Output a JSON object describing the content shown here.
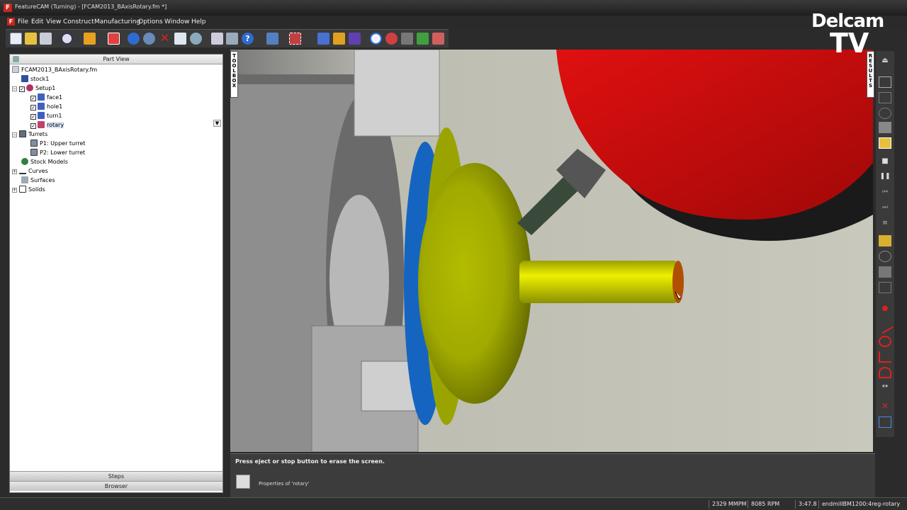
{
  "window": {
    "title": "FeatureCAM (Turning) - [FCAM2013_BAxisRotary.fm *]"
  },
  "menu": {
    "items": [
      "File",
      "Edit",
      "View",
      "Construct",
      "Manufacturing",
      "Options",
      "Window",
      "Help"
    ]
  },
  "logo": {
    "line1": "Delcam",
    "line2": "TV"
  },
  "panel": {
    "title": "Part View",
    "tree": [
      {
        "label": "FCAM2013_BAxisRotary.fm",
        "icon": "document-icon"
      },
      {
        "label": "stock1",
        "icon": "stock-icon"
      },
      {
        "label": "Setup1",
        "icon": "setup-icon"
      },
      {
        "label": "face1",
        "icon": "feature-icon"
      },
      {
        "label": "hole1",
        "icon": "feature-icon"
      },
      {
        "label": "turn1",
        "icon": "feature-icon"
      },
      {
        "label": "rotary",
        "icon": "feature-icon"
      },
      {
        "label": "Turrets",
        "icon": "turret-icon"
      },
      {
        "label": "P1: Upper turret",
        "icon": "turret-icon"
      },
      {
        "label": "P2: Lower turret",
        "icon": "turret-icon"
      },
      {
        "label": "Stock Models",
        "icon": "stock-model-icon"
      },
      {
        "label": "Curves",
        "icon": "curve-icon"
      },
      {
        "label": "Surfaces",
        "icon": "surface-icon"
      },
      {
        "label": "Solids",
        "icon": "solid-icon"
      }
    ],
    "footer_steps": "Steps",
    "footer_browser": "Browser"
  },
  "toolbox_tab": "TOOLBOX",
  "results_tab": "RESULTS",
  "message": {
    "text": "Press eject or stop button to erase the screen.",
    "properties": "Properties of 'rotary'"
  },
  "status": {
    "feed": "2329 MMPM",
    "speed": "8085 RPM",
    "time": "3:47.8",
    "tool": "endmillBM1200:4reg-rotary"
  },
  "colors": {
    "part_yellow": "#c8d400",
    "chuck_blue": "#1565c0",
    "spindle_red": "#d40b0b",
    "background_gray": "#c2c2b8"
  }
}
